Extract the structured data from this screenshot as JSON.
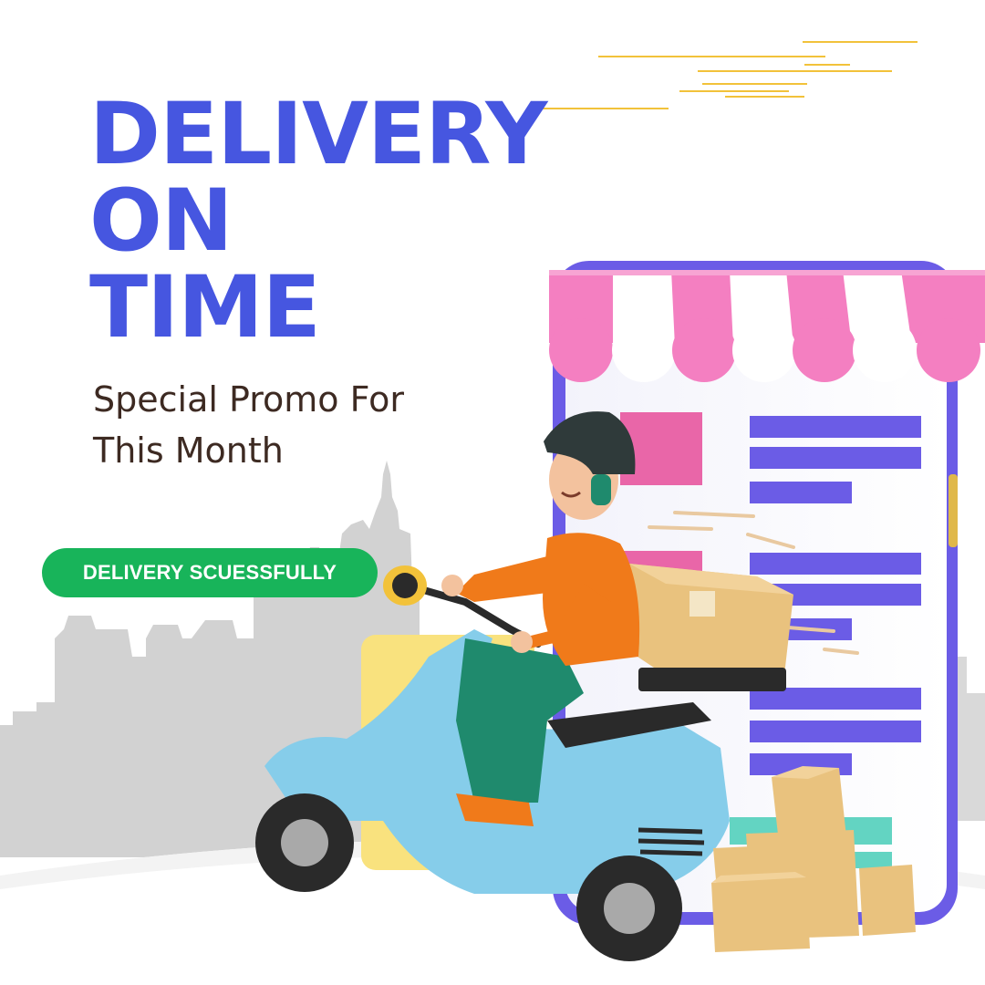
{
  "poster": {
    "headline": [
      "DELIVERY",
      "ON",
      "TIME"
    ],
    "subtitle": [
      "Special Promo For",
      "This Month"
    ],
    "badge_label": "DELIVERY SCUESSFULLY"
  },
  "colors": {
    "headline": "#4656e0",
    "subtitle": "#3d2a22",
    "badge": "#18b45a",
    "awning_pink": "#f47fc1",
    "phone_frame": "#6b5ce6",
    "scooter": "#86cdea",
    "box": "#e9c27e"
  },
  "illustration": {
    "icons": [
      "city-skyline",
      "smartphone-shop",
      "delivery-courier",
      "scooter",
      "parcel-box"
    ]
  }
}
